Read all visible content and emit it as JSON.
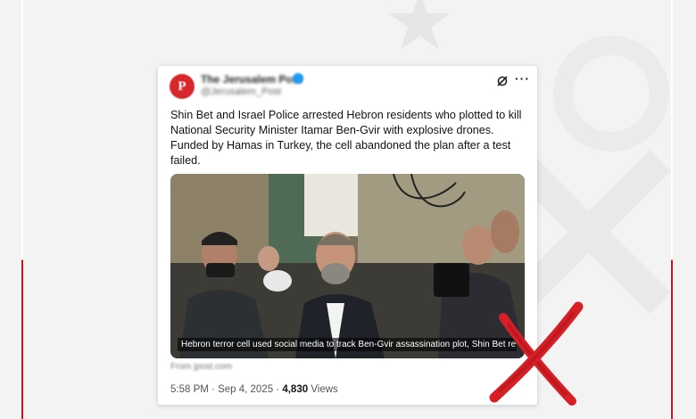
{
  "background": {
    "accent_color": "#c4161c"
  },
  "tweet": {
    "account_name": "The Jerusalem Post",
    "account_handle": "@Jerusalem_Post",
    "avatar_letter": "P",
    "avatar_color": "#d7262c",
    "verified": true,
    "text": "Shin Bet and Israel Police arrested Hebron residents who plotted to kill National Security Minister Itamar Ben-Gvir with explosive drones. Funded by Hamas in Turkey, the cell abandoned the plan after a test failed.",
    "media_caption": "Hebron terror cell used social media to track Ben-Gvir assassination plot, Shin Bet rev...",
    "link_domain": "From jpost.com",
    "time": "5:58 PM",
    "date": "Sep 4, 2025",
    "views_count": "4,830",
    "views_label": "Views",
    "icons": [
      "grok-icon",
      "more-options-icon"
    ]
  },
  "overlay": {
    "mark": "red-x-icon",
    "color": "#d81f26"
  }
}
